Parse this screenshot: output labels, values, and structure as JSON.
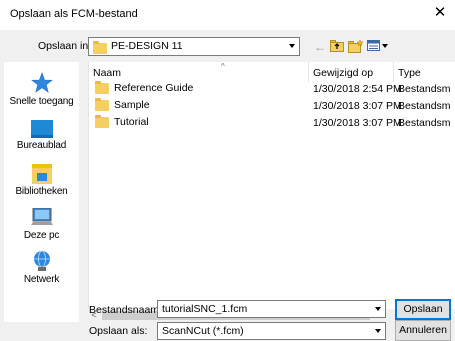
{
  "window": {
    "title": "Opslaan als FCM-bestand",
    "close_glyph": "✕"
  },
  "location": {
    "label": "Opslaan in:",
    "value": "PE-DESIGN 11"
  },
  "places": [
    {
      "label": "Snelle toegang",
      "icon": "star-icon"
    },
    {
      "label": "Bureaublad",
      "icon": "desktop-icon"
    },
    {
      "label": "Bibliotheken",
      "icon": "library-icon"
    },
    {
      "label": "Deze pc",
      "icon": "computer-icon"
    },
    {
      "label": "Netwerk",
      "icon": "network-icon"
    }
  ],
  "columns": {
    "name": "Naam",
    "modified": "Gewijzigd op",
    "type": "Type"
  },
  "files": [
    {
      "name": "Reference Guide",
      "modified": "1/30/2018 2:54 PM",
      "type": "Bestandsm"
    },
    {
      "name": "Sample",
      "modified": "1/30/2018 3:07 PM",
      "type": "Bestandsm"
    },
    {
      "name": "Tutorial",
      "modified": "1/30/2018 3:07 PM",
      "type": "Bestandsm"
    }
  ],
  "filename": {
    "label": "Bestandsnaam:",
    "value": "tutorialSNC_1.fcm"
  },
  "filetype": {
    "label": "Opslaan als:",
    "value": "ScanNCut (*.fcm)"
  },
  "buttons": {
    "save": "Opslaan",
    "cancel": "Annuleren"
  },
  "colors": {
    "accent": "#0078d7",
    "folder": "#f5cf63"
  }
}
